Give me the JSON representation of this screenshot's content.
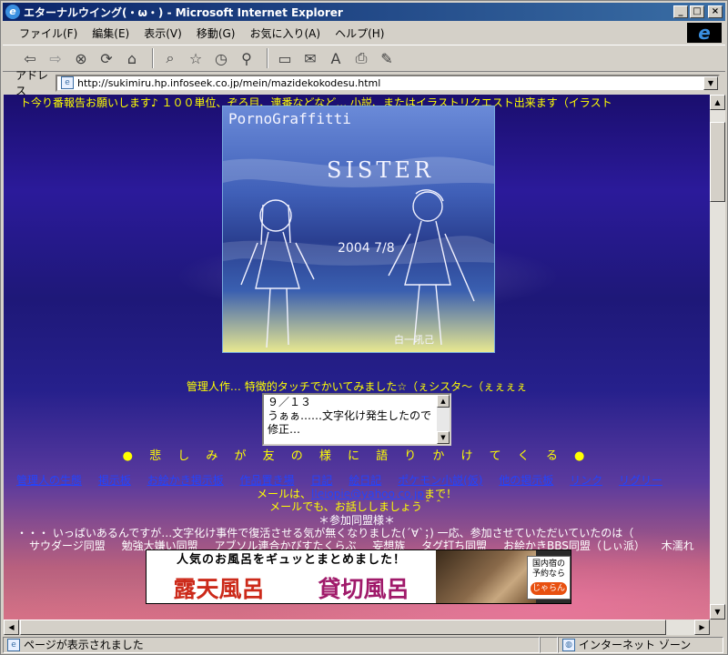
{
  "window": {
    "title": "エターナルウイング(・ω・) - Microsoft Internet Explorer",
    "controls": {
      "minimize": "_",
      "maximize": "□",
      "close": "×"
    }
  },
  "menu": [
    "ファイル(F)",
    "編集(E)",
    "表示(V)",
    "移動(G)",
    "お気に入り(A)",
    "ヘルプ(H)"
  ],
  "address": {
    "label": "アドレス",
    "url": "http://sukimiru.hp.infoseek.co.jp/mein/mazidekokodesu.html"
  },
  "page": {
    "marquee": "ト今り番報告お願いします♪ １００単位、ぞろ目、連番などなど… 小説、またはイラストリクエスト出来ます（イラスト",
    "artwork_texts": {
      "title": "PornoGraffitti",
      "subtitle": "SISTER",
      "date": "2004 7/8",
      "signature": "白一吼己"
    },
    "caption": "管理人作… 特徴的タッチでかいてみました☆（ぇシスタ～（ぇぇぇぇ",
    "news_box": {
      "date": "９／１３",
      "text": "うぁぁ……文字化け発生したので修正…"
    },
    "slogan": "● 悲 し み が 友 の 様 に 語 り か け て く る ●",
    "nav_links": [
      "管理人の生態",
      "掲示板",
      "お絵かき掲示板",
      "作品置き場",
      "日記",
      "絵日記",
      "ポケモン小説(仮)",
      "他の掲示板",
      "リンク",
      "リグリー"
    ],
    "mail_line1_prefix": "メールは、",
    "mail_address": "lleiopie@yahoo.co.jp",
    "mail_line1_suffix": "まで！",
    "mail_line2": "メールでも、お話ししましょう＾＾",
    "joined_heading": "＊参加同盟様＊",
    "joined_note": "・・・ いっぱいあるんですが…文字化け事件で復活させる気が無くなりました(´∀`；) 一応、参加させていただいていたのは（",
    "groups": [
      "サウダージ同盟",
      "勉強大嫌い同盟",
      "アブソル連合かびすたくらぶ",
      "妄想族",
      "タグ打ち同盟",
      "お絵かきBBS同盟（しぃ派）",
      "木濡れ"
    ],
    "banner": {
      "headline": "人気のお風呂をギュッとまとめました！",
      "left": "露天風呂",
      "right": "貸切風呂",
      "badge_line1": "国内宿の",
      "badge_line2": "予約なら",
      "badge_logo": "じゃらん"
    }
  },
  "status": {
    "text": "ページが表示されました",
    "zone": "インターネット ゾーン"
  },
  "colors": {
    "title_bar": "#0a246a",
    "page_text": "#ffff00",
    "link": "#2244ff"
  }
}
